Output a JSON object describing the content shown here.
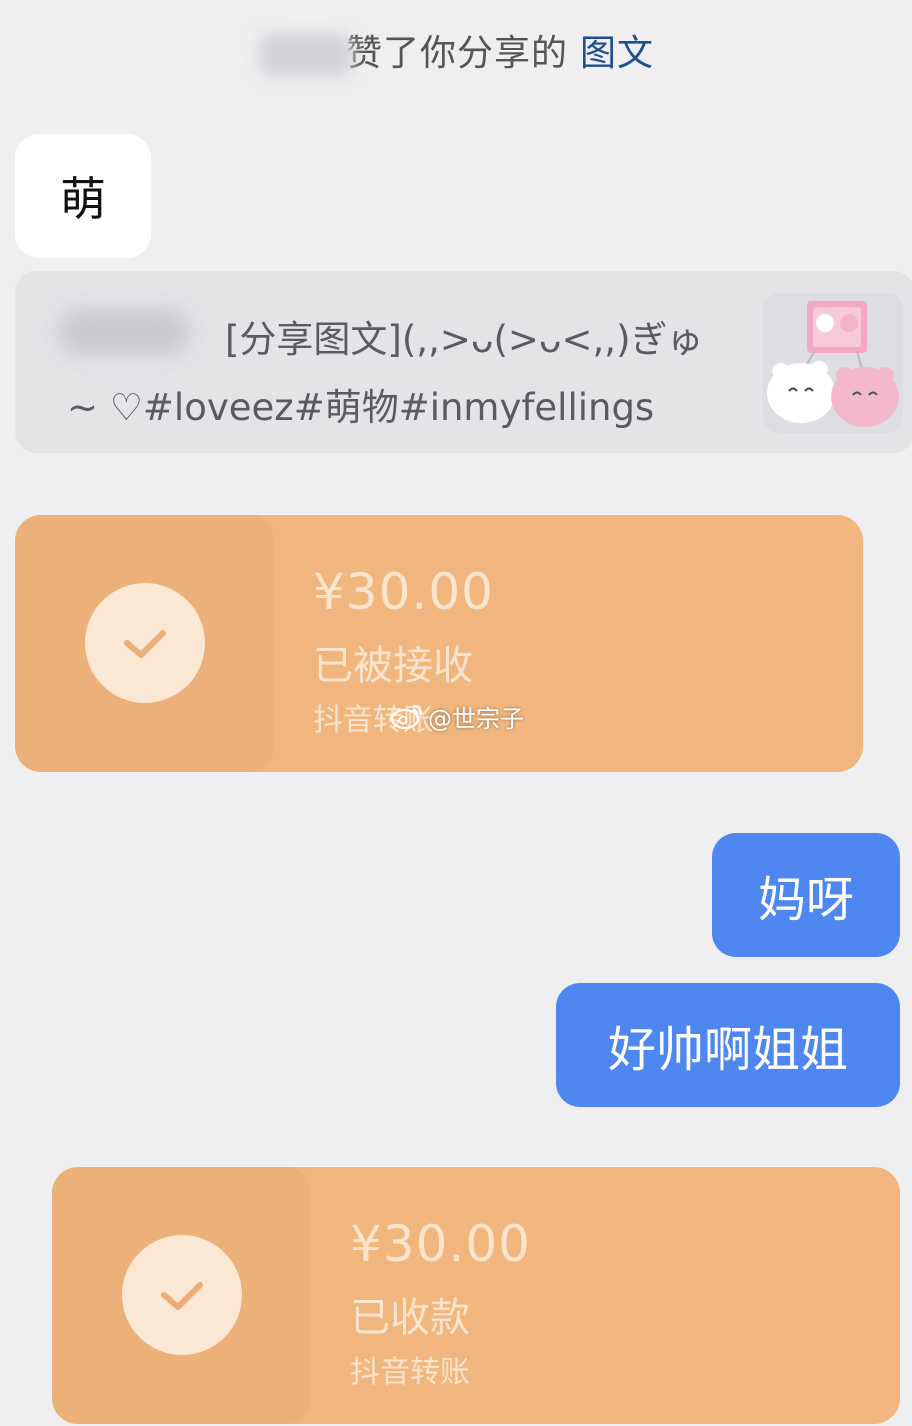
{
  "notice": {
    "text": "赞了你分享的",
    "link": "图文"
  },
  "messages": {
    "incoming_text": "萌",
    "share_card": {
      "line1": "[分享图文](,,>ᴗ(>ᴗ<,,)ぎゅ",
      "line2": "~ ♡#loveez#萌物#inmyfellings"
    },
    "transfer1": {
      "amount": "¥30.00",
      "status": "已被接收",
      "source": "抖音转账"
    },
    "outgoing1": "妈呀",
    "outgoing2": "好帅啊姐姐",
    "transfer2": {
      "amount": "¥30.00",
      "status": "已收款",
      "source": "抖音转账"
    }
  },
  "watermark": {
    "text": "@世宗子"
  },
  "colors": {
    "background": "#efeff1",
    "transfer_card": "#f0b67e",
    "outgoing_bubble": "#4f87f0",
    "link": "#1f4e8c"
  }
}
